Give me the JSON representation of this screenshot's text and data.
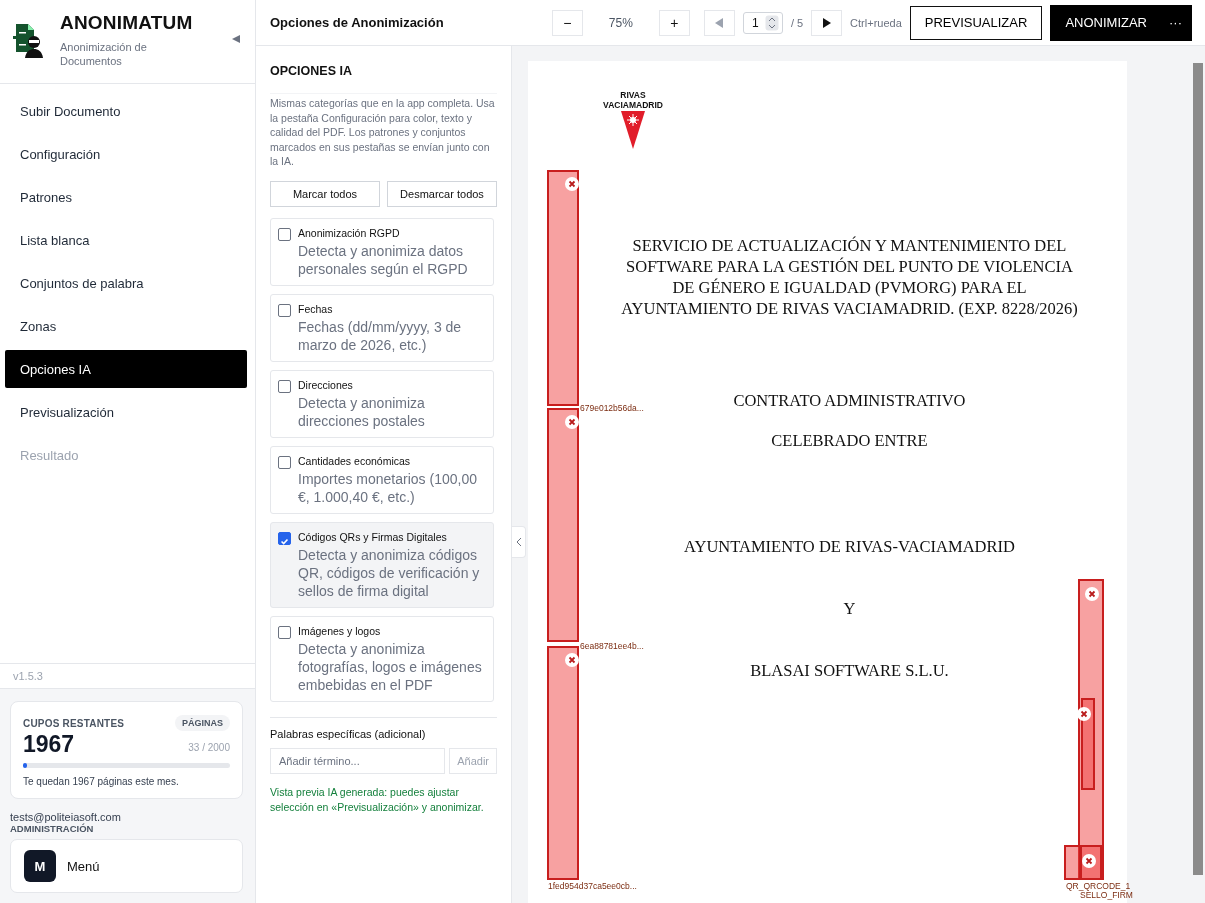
{
  "sidebar": {
    "app_name": "ANONIMATUM",
    "subtitle": "Anonimización de Documentos",
    "nav": [
      {
        "label": "Subir Documento",
        "selected": false,
        "disabled": false
      },
      {
        "label": "Configuración",
        "selected": false,
        "disabled": false
      },
      {
        "label": "Patrones",
        "selected": false,
        "disabled": false
      },
      {
        "label": "Lista blanca",
        "selected": false,
        "disabled": false
      },
      {
        "label": "Conjuntos de palabra",
        "selected": false,
        "disabled": false
      },
      {
        "label": "Zonas",
        "selected": false,
        "disabled": false
      },
      {
        "label": "Opciones IA",
        "selected": true,
        "disabled": false
      },
      {
        "label": "Previsualización",
        "selected": false,
        "disabled": false
      },
      {
        "label": "Resultado",
        "selected": false,
        "disabled": true
      }
    ],
    "version": "v1.5.3",
    "quota": {
      "title": "CUPOS RESTANTES",
      "badge": "PÁGINAS",
      "value": "1967",
      "usage": "33 / 2000",
      "level": 0.0165,
      "note": "Te quedan 1967 páginas este mes."
    },
    "user": {
      "email": "tests@politeiasoft.com",
      "role": "ADMINISTRACIÓN"
    },
    "menu": {
      "avatar": "M",
      "label": "Menú"
    }
  },
  "toolbar": {
    "title": "Opciones de Anonimización",
    "zoom_out": "−",
    "zoom": "75%",
    "zoom_in": "+",
    "page": "1",
    "page_total": "/ 5",
    "hint": "Ctrl+rueda",
    "preview_button": "PREVISUALIZAR",
    "anonymize_button": "ANONIMIZAR",
    "more": "···"
  },
  "options": {
    "heading": "OPCIONES IA",
    "description": "Mismas categorías que en la app completa. Usa la pestaña Configuración para color, texto y calidad del PDF. Los patrones y conjuntos marcados en sus pestañas se envían junto con la IA.",
    "select_all": "Marcar todos",
    "deselect_all": "Desmarcar todos",
    "categories": [
      {
        "title": "Anonimización RGPD",
        "description": "Detecta y anonimiza datos personales según el RGPD",
        "checked": false
      },
      {
        "title": "Fechas",
        "description": "Fechas (dd/mm/yyyy, 3 de marzo de 2026, etc.)",
        "checked": false
      },
      {
        "title": "Direcciones",
        "description": "Detecta y anonimiza direcciones postales",
        "checked": false
      },
      {
        "title": "Cantidades económicas",
        "description": "Importes monetarios (100,00 €, 1.000,40 €, etc.)",
        "checked": false
      },
      {
        "title": "Códigos QRs y Firmas Digitales",
        "description": "Detecta y anonimiza códigos QR, códigos de verificación y sellos de firma digital",
        "checked": true
      },
      {
        "title": "Imágenes y logos",
        "description": "Detecta y anonimiza fotografías, logos e imágenes embebidas en el PDF",
        "checked": false
      }
    ],
    "extra_heading": "Palabras específicas (adicional)",
    "extra_placeholder": "Añadir término...",
    "add_button": "Añadir",
    "status": "Vista previa IA generada: puedes ajustar selección en «Previsualización» y anonimizar."
  },
  "document": {
    "logo_text": "RIVAS VACIAMADRID",
    "title": "SERVICIO DE ACTUALIZACIÓN Y MANTENIMIENTO DEL SOFTWARE PARA LA GESTIÓN DEL PUNTO DE VIOLENCIA DE GÉNERO E IGUALDAD (PVMORG) PARA EL AYUNTAMIENTO DE RIVAS VACIAMADRID. (EXP. 8228/2026)",
    "lines": [
      "CONTRATO ADMINISTRATIVO",
      "CELEBRADO ENTRE",
      "AYUNTAMIENTO DE RIVAS-VACIAMADRID",
      "Y",
      "BLASAI SOFTWARE S.L.U."
    ],
    "redaction_labels": [
      "679e012b56da...",
      "6ea88781ee4b...",
      "1fed954d37ca5ee0cb...",
      "QR_QRCODE_1",
      "SELLO_FIRM"
    ]
  }
}
